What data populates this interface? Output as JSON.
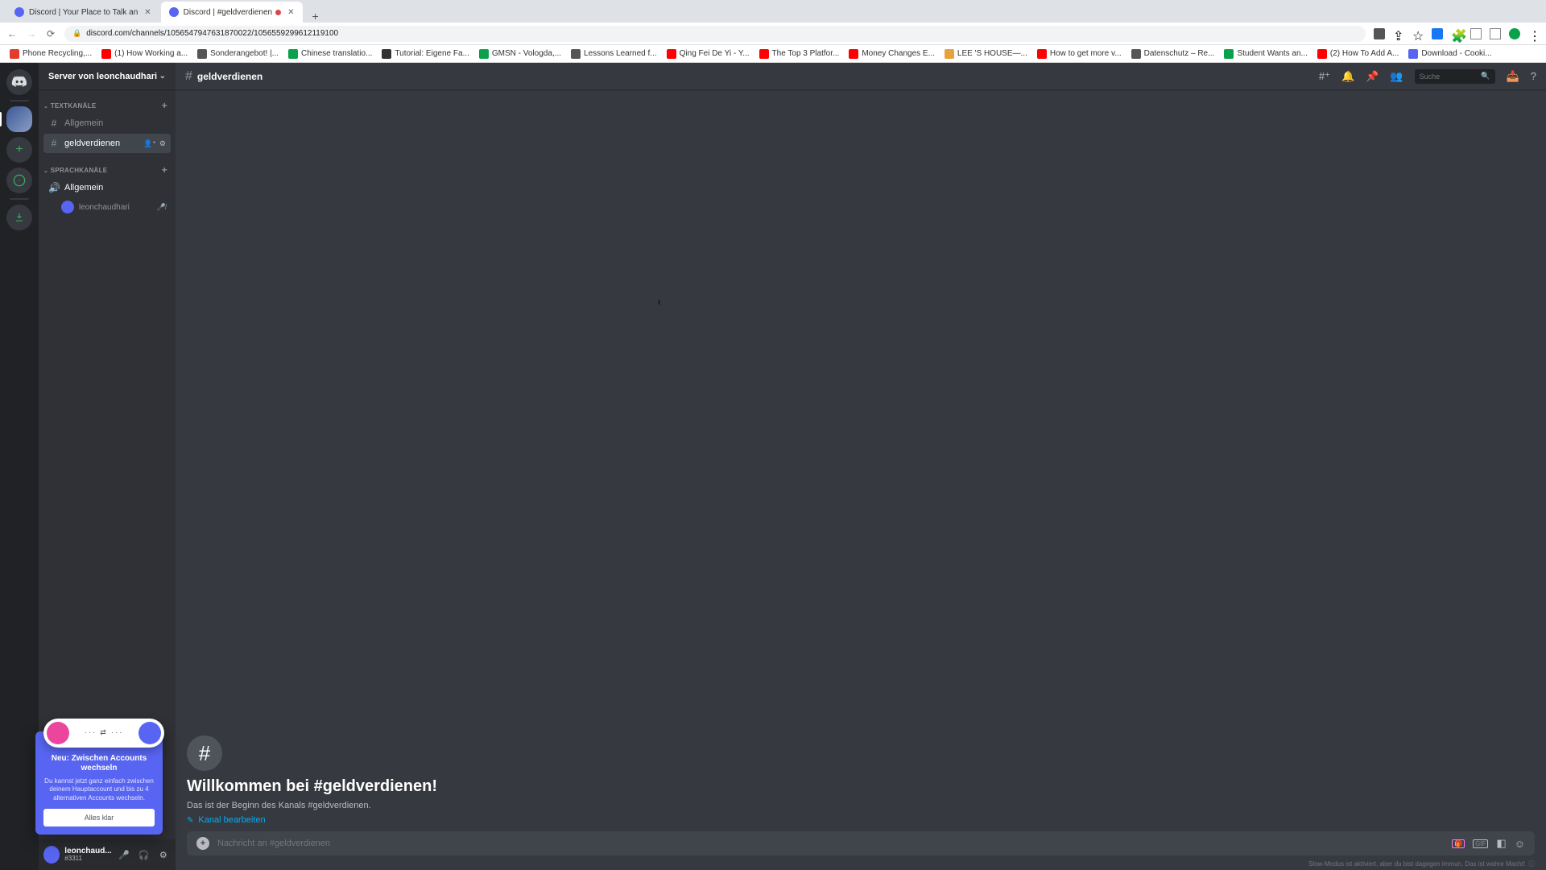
{
  "browser": {
    "tabs": [
      {
        "title": "Discord | Your Place to Talk an",
        "favColor": "#5865f2",
        "active": false
      },
      {
        "title": "Discord | #geldverdienen",
        "favColor": "#5865f2",
        "active": true,
        "recording": true
      }
    ],
    "url": "discord.com/channels/1056547947631870022/1056559299612119100",
    "bookmarks": [
      {
        "label": "Phone Recycling,...",
        "color": "#e33b2e"
      },
      {
        "label": "(1) How Working a...",
        "color": "#ff0000"
      },
      {
        "label": "Sonderangebot! |...",
        "color": "#555"
      },
      {
        "label": "Chinese translatio...",
        "color": "#0aa14b"
      },
      {
        "label": "Tutorial: Eigene Fa...",
        "color": "#333"
      },
      {
        "label": "GMSN - Vologda,...",
        "color": "#0aa14b"
      },
      {
        "label": "Lessons Learned f...",
        "color": "#555"
      },
      {
        "label": "Qing Fei De Yi - Y...",
        "color": "#ff0000"
      },
      {
        "label": "The Top 3 Platfor...",
        "color": "#ff0000"
      },
      {
        "label": "Money Changes E...",
        "color": "#ff0000"
      },
      {
        "label": "LEE 'S HOUSE—...",
        "color": "#e6a23c"
      },
      {
        "label": "How to get more v...",
        "color": "#ff0000"
      },
      {
        "label": "Datenschutz – Re...",
        "color": "#555"
      },
      {
        "label": "Student Wants an...",
        "color": "#0aa14b"
      },
      {
        "label": "(2) How To Add A...",
        "color": "#ff0000"
      },
      {
        "label": "Download - Cooki...",
        "color": "#5865f2"
      }
    ]
  },
  "discord": {
    "serverName": "Server von leonchaudhari",
    "categories": {
      "text": {
        "label": "TEXTKANÄLE"
      },
      "voice": {
        "label": "SPRACHKANÄLE"
      }
    },
    "textChannels": [
      {
        "name": "Allgemein"
      },
      {
        "name": "geldverdienen",
        "active": true
      }
    ],
    "voiceChannels": [
      {
        "name": "Allgemein",
        "users": [
          {
            "name": "leonchaudhari"
          }
        ]
      }
    ],
    "currentChannel": "geldverdienen",
    "search": {
      "placeholder": "Suche"
    },
    "welcome": {
      "title": "Willkommen bei #geldverdienen!",
      "subtitle": "Das ist der Beginn des Kanals #geldverdienen.",
      "editLabel": "Kanal bearbeiten"
    },
    "composer": {
      "placeholder": "Nachricht an #geldverdienen",
      "gif": "GIF"
    },
    "slowMode": "Slow-Modus ist aktiviert, aber du bist dagegen immun. Das ist wahre Macht!",
    "userDock": {
      "name": "leonchaud...",
      "tag": "#3311"
    },
    "popover": {
      "title": "Neu: Zwischen Accounts wechseln",
      "desc": "Du kannst jetzt ganz einfach zwischen deinem Hauptaccount und bis zu 4 alternativen Accounts wechseln.",
      "button": "Alles klar"
    }
  }
}
